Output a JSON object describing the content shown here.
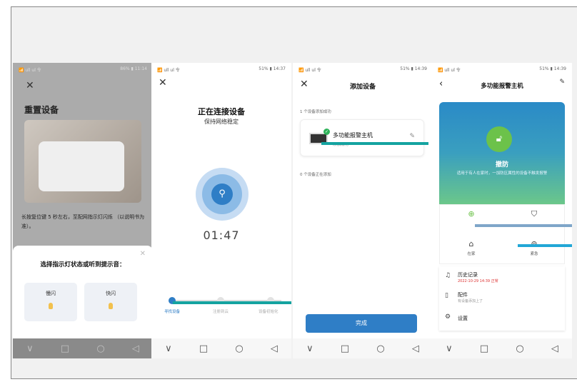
{
  "phones": [
    {
      "status_left": "📶 ull ul 令",
      "status_right": "86% ▮ 11:14",
      "title": "重置设备",
      "desc": "长按复位键 5 秒左右，至配网指示灯闪烁 （以说明书为准）。",
      "sheet_title": "选择指示灯状态或听到提示音：",
      "opt1": "慢闪",
      "opt2": "快闪"
    },
    {
      "status_left": "📶 ull ul 令",
      "status_right": "51% ▮ 14:37",
      "title": "正在连接设备",
      "subtitle": "保持网络稳定",
      "timer": "01:47",
      "step1": "寻找设备",
      "step2": "注册到云",
      "step3": "设备初始化"
    },
    {
      "status_left": "📶 ull ul 令",
      "status_right": "51% ▮ 14:39",
      "title": "添加设备",
      "added": "1 个设备添加成功",
      "device_name": "多功能报警主机",
      "device_sub": "添加成功",
      "adding": "0 个设备正在添加",
      "done": "完成"
    },
    {
      "status_left": "📶 ull ul 令",
      "status_right": "51% ▮ 14:39",
      "title": "多功能报警主机",
      "mode": "撤防",
      "mode_desc": "适用于有人在家时，一加防区属性的设备不触发报警",
      "home": "在家",
      "sos": "紧急",
      "history": "历史记录",
      "history_sub": "2022-10-29 14:39 正常",
      "parts": "配件",
      "parts_sub": "有设备添加上了",
      "settings": "设置"
    }
  ]
}
